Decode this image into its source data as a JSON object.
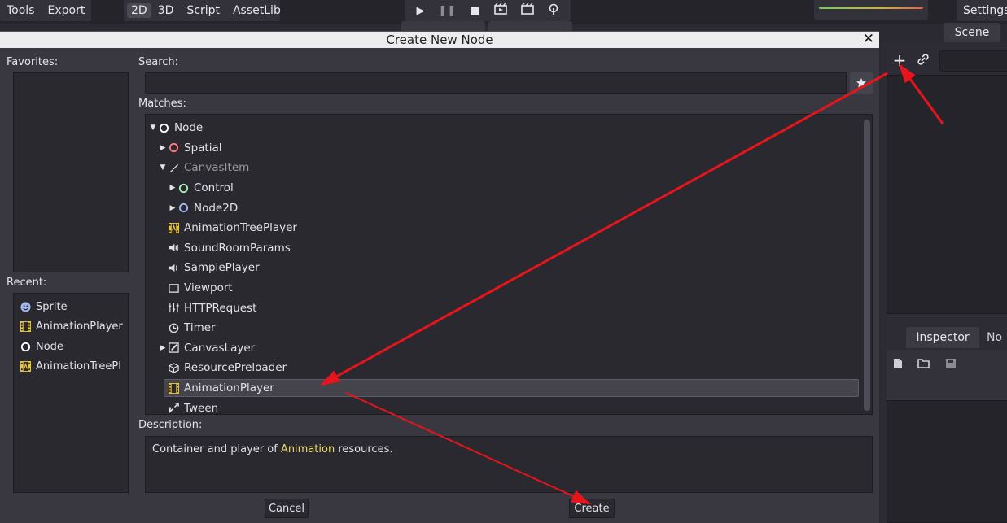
{
  "topbar": {
    "menus_left": [
      "Tools",
      "Export"
    ],
    "view_modes": [
      "2D",
      "3D",
      "Script",
      "AssetLib"
    ],
    "active_view": "2D",
    "playback_icons": [
      "play-icon",
      "pause-icon",
      "stop-icon",
      "play-scene-icon",
      "play-custom-icon",
      "remote-icon"
    ],
    "settings_label": "Settings"
  },
  "scene_dock": {
    "tab_label": "Scene",
    "add_icon": "+",
    "link_icon": "link-icon"
  },
  "inspector_dock": {
    "tab_label": "Inspector",
    "other_tab_label": "No",
    "toolbar_icons": [
      "new-resource-icon",
      "open-resource-icon",
      "save-resource-icon"
    ]
  },
  "dialog": {
    "title": "Create New Node",
    "close_glyph": "✕",
    "favorites_label": "Favorites:",
    "recent_label": "Recent:",
    "search_label": "Search:",
    "search_value": "",
    "matches_label": "Matches:",
    "description_label": "Description:",
    "description": {
      "before": "Container and player of ",
      "highlight": "Animation",
      "after": " resources."
    },
    "cancel_label": "Cancel",
    "create_label": "Create",
    "recent_items": [
      {
        "label": "Sprite",
        "icon": "sprite-icon"
      },
      {
        "label": "AnimationPlayer",
        "icon": "animation-player-icon"
      },
      {
        "label": "Node",
        "icon": "node-icon"
      },
      {
        "label": "AnimationTreePl",
        "icon": "animation-tree-player-icon"
      }
    ],
    "matches": [
      {
        "label": "Node",
        "level": 0,
        "arrow": "expanded",
        "icon": "node-icon",
        "color": "#ffffff",
        "dim": false,
        "selected": false
      },
      {
        "label": "Spatial",
        "level": 1,
        "arrow": "collapsed",
        "icon": "spatial-icon",
        "color": "#fc7f7f",
        "dim": false,
        "selected": false
      },
      {
        "label": "CanvasItem",
        "level": 1,
        "arrow": "expanded",
        "icon": "canvas-item-icon",
        "color": "#e0e0e0",
        "dim": true,
        "selected": false
      },
      {
        "label": "Control",
        "level": 2,
        "arrow": "collapsed",
        "icon": "control-icon",
        "color": "#a5efac",
        "dim": false,
        "selected": false
      },
      {
        "label": "Node2D",
        "level": 2,
        "arrow": "collapsed",
        "icon": "node2d-icon",
        "color": "#a5b7f3",
        "dim": false,
        "selected": false
      },
      {
        "label": "AnimationTreePlayer",
        "level": 1,
        "arrow": "none",
        "icon": "animation-tree-player-icon",
        "color": "#e9c53a",
        "dim": false,
        "selected": false
      },
      {
        "label": "SoundRoomParams",
        "level": 1,
        "arrow": "none",
        "icon": "sound-room-params-icon",
        "color": "#e0e0e0",
        "dim": false,
        "selected": false
      },
      {
        "label": "SamplePlayer",
        "level": 1,
        "arrow": "none",
        "icon": "sample-player-icon",
        "color": "#e0e0e0",
        "dim": false,
        "selected": false
      },
      {
        "label": "Viewport",
        "level": 1,
        "arrow": "none",
        "icon": "viewport-icon",
        "color": "#e0e0e0",
        "dim": false,
        "selected": false
      },
      {
        "label": "HTTPRequest",
        "level": 1,
        "arrow": "none",
        "icon": "http-request-icon",
        "color": "#e0e0e0",
        "dim": false,
        "selected": false
      },
      {
        "label": "Timer",
        "level": 1,
        "arrow": "none",
        "icon": "timer-icon",
        "color": "#e0e0e0",
        "dim": false,
        "selected": false
      },
      {
        "label": "CanvasLayer",
        "level": 1,
        "arrow": "collapsed",
        "icon": "canvas-layer-icon",
        "color": "#e0e0e0",
        "dim": false,
        "selected": false
      },
      {
        "label": "ResourcePreloader",
        "level": 1,
        "arrow": "none",
        "icon": "resource-preloader-icon",
        "color": "#e0e0e0",
        "dim": false,
        "selected": false
      },
      {
        "label": "AnimationPlayer",
        "level": 1,
        "arrow": "none",
        "icon": "animation-player-icon",
        "color": "#e9c53a",
        "dim": false,
        "selected": true
      },
      {
        "label": "Tween",
        "level": 1,
        "arrow": "none",
        "icon": "tween-icon",
        "color": "#e0e0e0",
        "dim": false,
        "selected": false
      }
    ]
  },
  "annotation_color": "#e8141b"
}
